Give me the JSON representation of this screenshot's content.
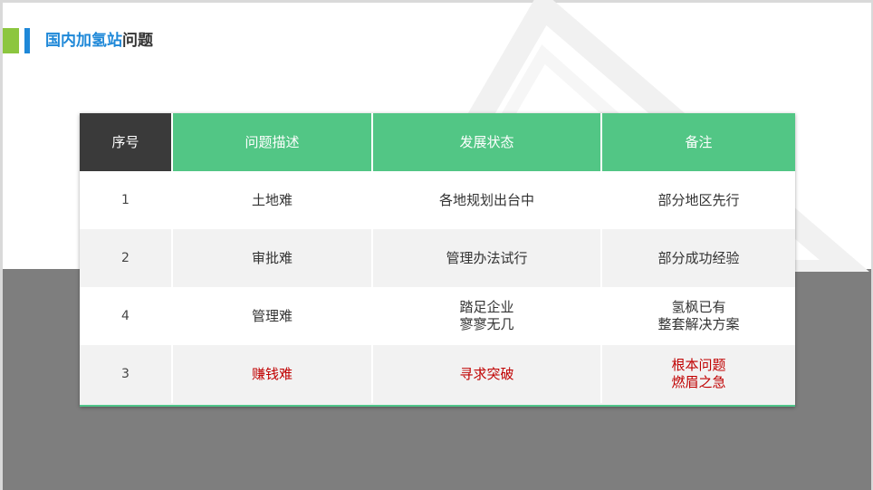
{
  "title": {
    "part1": "国内加氢站",
    "part2": "问题"
  },
  "table": {
    "headers": [
      "序号",
      "问题描述",
      "发展状态",
      "备注"
    ],
    "rows": [
      {
        "seq": "1",
        "issue": "土地难",
        "status": [
          "各地规划出台中"
        ],
        "note": [
          "部分地区先行"
        ]
      },
      {
        "seq": "2",
        "issue": "审批难",
        "status": [
          "管理办法试行"
        ],
        "note": [
          "部分成功经验"
        ]
      },
      {
        "seq": "4",
        "issue": "管理难",
        "status": [
          "踏足企业",
          "寥寥无几"
        ],
        "note": [
          "氢枫已有",
          "整套解决方案"
        ]
      },
      {
        "seq": "3",
        "issue": "赚钱难",
        "status": [
          "寻求突破"
        ],
        "note": [
          "根本问题",
          "燃眉之急"
        ]
      }
    ]
  },
  "colors": {
    "header_green": "#52c685",
    "header_dark": "#3a3a3a",
    "accent_blue": "#1e88d8",
    "accent_green": "#8cc63f",
    "highlight_red": "#c00000",
    "bottom_grey": "#7e7e7e"
  }
}
